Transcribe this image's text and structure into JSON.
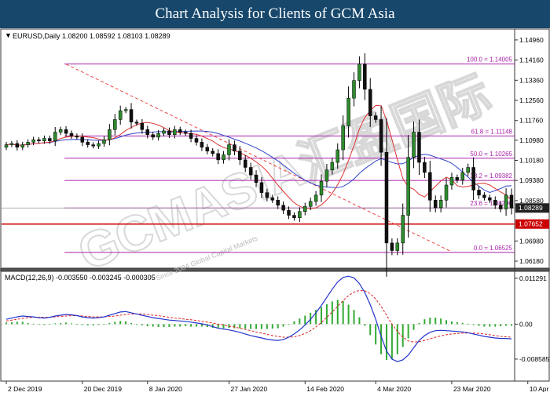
{
  "banner": {
    "title": "Chart Analysis for Clients of GCM Asia"
  },
  "watermark": {
    "text": "GCMASIA汇盈国际",
    "sub": "Since 2004 Global Capital Markets"
  },
  "colors": {
    "banner": "#17476b",
    "bull": "#2e8b2e",
    "bear": "#111111",
    "ma_red": "#dd3333",
    "ma_blue": "#3344cc",
    "fib": "#aa22aa",
    "support": "#cc0000",
    "trend": "#ee4444",
    "macd_line": "#2233cc",
    "macd_signal": "#dd2222",
    "macd_hist": "#33aa33",
    "current_price_tag": "#222222"
  },
  "chart_data": [
    {
      "type": "candlestick",
      "panel": "price",
      "header": "EURUSD,Daily  1.08200 1.08592 1.08103 1.08289",
      "symbol_marker": "▼",
      "ylim": [
        1.059,
        1.153
      ],
      "y_ticks": [
        "1.14960",
        "1.14160",
        "1.13360",
        "1.12560",
        "1.11760",
        "1.10980",
        "1.10180",
        "1.09380",
        "1.08580",
        "1.06980",
        "1.06180"
      ],
      "x_ticks": [
        {
          "label": "2 Dec 2019",
          "idx": 0
        },
        {
          "label": "20 Dec 2019",
          "idx": 14
        },
        {
          "label": "8 Jan 2020",
          "idx": 26
        },
        {
          "label": "27 Jan 2020",
          "idx": 41
        },
        {
          "label": "14 Feb 2020",
          "idx": 55
        },
        {
          "label": "4 Mar 2020",
          "idx": 68
        },
        {
          "label": "23 Mar 2020",
          "idx": 82
        },
        {
          "label": "10 Apr 2020",
          "idx": 96
        }
      ],
      "closes": [
        1.108,
        1.1085,
        1.107,
        1.108,
        1.109,
        1.11,
        1.1095,
        1.1105,
        1.1095,
        1.113,
        1.114,
        1.1125,
        1.1115,
        1.111,
        1.109,
        1.108,
        1.1075,
        1.1085,
        1.11,
        1.114,
        1.118,
        1.1215,
        1.122,
        1.117,
        1.1165,
        1.114,
        1.112,
        1.111,
        1.1125,
        1.1135,
        1.112,
        1.114,
        1.113,
        1.1125,
        1.1105,
        1.109,
        1.107,
        1.1055,
        1.1045,
        1.102,
        1.104,
        1.108,
        1.1055,
        1.102,
        1.099,
        1.096,
        1.093,
        1.089,
        1.087,
        1.086,
        1.084,
        1.082,
        1.08,
        1.079,
        1.0815,
        1.0835,
        1.0855,
        1.088,
        1.0935,
        1.098,
        1.101,
        1.106,
        1.1155,
        1.1265,
        1.1335,
        1.14,
        1.13,
        1.1195,
        1.118,
        1.105,
        1.069,
        1.066,
        1.069,
        1.08,
        1.103,
        1.113,
        1.101,
        1.097,
        1.086,
        1.083,
        1.086,
        1.092,
        1.095,
        1.094,
        1.097,
        1.099,
        1.09,
        1.088,
        1.087,
        1.086,
        1.084,
        1.0825,
        1.088,
        1.0829
      ],
      "series": [
        {
          "name": "",
          "kind": "ma_fast"
        },
        {
          "name": "",
          "kind": "ma_slow"
        }
      ],
      "fibonacci": [
        {
          "label": "100.0 = 1.14005",
          "value": 1.14005
        },
        {
          "label": "61.8 = 1.11148",
          "value": 1.11148
        },
        {
          "label": "50.0 = 1.10265",
          "value": 1.10265
        },
        {
          "label": "38.2 = 1.09382",
          "value": 1.09382
        },
        {
          "label": "23.6 = 1.08290",
          "value": 1.0829
        },
        {
          "label": "0.0 = 1.06525",
          "value": 1.06525
        }
      ],
      "support_line": {
        "value": 1.07652,
        "label": "1.07652"
      },
      "current_price": {
        "value": 1.08289,
        "label": "1.08289"
      },
      "trendline": {
        "from": [
          1.14,
          11
        ],
        "to": [
          1.0655,
          82
        ]
      }
    },
    {
      "type": "bar",
      "panel": "macd",
      "header": "MACD(12,26,9) -0.003550 -0.003245 -0.000305",
      "ylim": [
        -0.014,
        0.013
      ],
      "y_ticks": [
        "0.011291",
        "0.00",
        "-0.008585"
      ],
      "macd_line": [
        0.0012,
        0.0015,
        0.0018,
        0.002,
        0.0019,
        0.0018,
        0.0016,
        0.0015,
        0.0017,
        0.002,
        0.0022,
        0.0024,
        0.0023,
        0.0021,
        0.0018,
        0.0016,
        0.0015,
        0.0016,
        0.0018,
        0.0022,
        0.0026,
        0.003,
        0.0031,
        0.0028,
        0.0025,
        0.0022,
        0.0019,
        0.0016,
        0.0014,
        0.0012,
        0.001,
        0.0009,
        0.0008,
        0.0007,
        0.0005,
        0.0003,
        0.0001,
        -0.0002,
        -0.0006,
        -0.001,
        -0.0012,
        -0.0014,
        -0.0017,
        -0.002,
        -0.0024,
        -0.0028,
        -0.0031,
        -0.0034,
        -0.0037,
        -0.0039,
        -0.004,
        -0.0038,
        -0.0032,
        -0.0024,
        -0.0014,
        -0.0002,
        0.0012,
        0.0028,
        0.0046,
        0.0066,
        0.0086,
        0.0104,
        0.0115,
        0.0118,
        0.0114,
        0.01,
        0.0078,
        0.0048,
        0.0012,
        -0.003,
        -0.0066,
        -0.0086,
        -0.0092,
        -0.0088,
        -0.0076,
        -0.0058,
        -0.004,
        -0.0028,
        -0.002,
        -0.0016,
        -0.0015,
        -0.0016,
        -0.0017,
        -0.0018,
        -0.0019,
        -0.0021,
        -0.0024,
        -0.0027,
        -0.003,
        -0.0032,
        -0.0034,
        -0.0035,
        -0.0035,
        -0.0036
      ],
      "signal_line": [
        0.0008,
        0.001,
        0.0012,
        0.0014,
        0.0016,
        0.0017,
        0.0017,
        0.0017,
        0.0017,
        0.0018,
        0.0019,
        0.002,
        0.0021,
        0.0021,
        0.002,
        0.0019,
        0.0018,
        0.0018,
        0.0018,
        0.0019,
        0.002,
        0.0022,
        0.0024,
        0.0025,
        0.0025,
        0.0025,
        0.0024,
        0.0022,
        0.0021,
        0.0019,
        0.0017,
        0.0015,
        0.0014,
        0.0012,
        0.0011,
        0.0009,
        0.0007,
        0.0005,
        0.0003,
        0.0,
        -0.0002,
        -0.0005,
        -0.0007,
        -0.001,
        -0.0013,
        -0.0016,
        -0.0019,
        -0.0022,
        -0.0025,
        -0.0028,
        -0.003,
        -0.0032,
        -0.0032,
        -0.0031,
        -0.0028,
        -0.0023,
        -0.0016,
        -0.0007,
        0.0004,
        0.0017,
        0.003,
        0.0044,
        0.0058,
        0.007,
        0.0079,
        0.0083,
        0.0082,
        0.0075,
        0.0062,
        0.0044,
        0.0022,
        0.0,
        -0.0018,
        -0.0032,
        -0.0041,
        -0.0044,
        -0.0043,
        -0.004,
        -0.0036,
        -0.0032,
        -0.0029,
        -0.0026,
        -0.0024,
        -0.0023,
        -0.0022,
        -0.0022,
        -0.0022,
        -0.0023,
        -0.0024,
        -0.0026,
        -0.0028,
        -0.003,
        -0.0031,
        -0.0032
      ]
    }
  ]
}
